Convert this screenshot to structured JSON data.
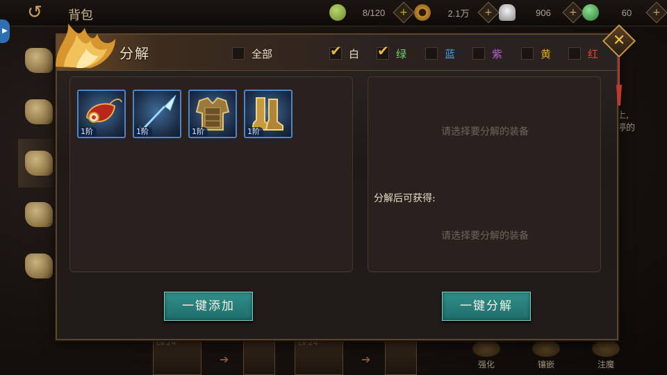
{
  "topbar": {
    "back_icon": "back-arrow-icon",
    "title": "背包",
    "resources": [
      {
        "icon": "bag-capacity-icon",
        "value": "8/120",
        "color": "#7f9a45"
      },
      {
        "icon": "copper-coin-icon",
        "value": "2.1万",
        "color": "#b7842f"
      },
      {
        "icon": "silver-ingot-icon",
        "value": "906",
        "color": "#b9b9b9"
      },
      {
        "icon": "jade-icon",
        "value": "60",
        "color": "#3c8f4c"
      }
    ]
  },
  "background": {
    "right_text": [
      "上,",
      "停的"
    ],
    "cards": [
      {
        "lv": "LV.24"
      },
      {
        "lv": "LV.24"
      }
    ],
    "actions": [
      {
        "label": "强化"
      },
      {
        "label": "镶嵌"
      },
      {
        "label": "注魔"
      }
    ]
  },
  "modal": {
    "title": "分解",
    "filters": [
      {
        "label": "全部",
        "checked": false,
        "color": "#e8dcc6"
      },
      {
        "label": "白",
        "checked": true,
        "color": "#e8dcc6"
      },
      {
        "label": "绿",
        "checked": true,
        "color": "#6fd06a"
      },
      {
        "label": "蓝",
        "checked": false,
        "color": "#4e9bd6"
      },
      {
        "label": "紫",
        "checked": false,
        "color": "#b75fd4"
      },
      {
        "label": "黄",
        "checked": false,
        "color": "#e0a43a"
      },
      {
        "label": "红",
        "checked": false,
        "color": "#e04a3a"
      }
    ],
    "items": [
      {
        "name": "pendant-item",
        "tier": "1阶"
      },
      {
        "name": "spear-item",
        "tier": "1阶"
      },
      {
        "name": "armor-item",
        "tier": "1阶"
      },
      {
        "name": "boots-item",
        "tier": "1阶"
      }
    ],
    "right_panel": {
      "hint_top": "请选择要分解的装备",
      "gain_label": "分解后可获得:",
      "hint_bottom": "请选择要分解的装备"
    },
    "buttons": {
      "add_all": "一键添加",
      "decompose_all": "一键分解"
    }
  }
}
